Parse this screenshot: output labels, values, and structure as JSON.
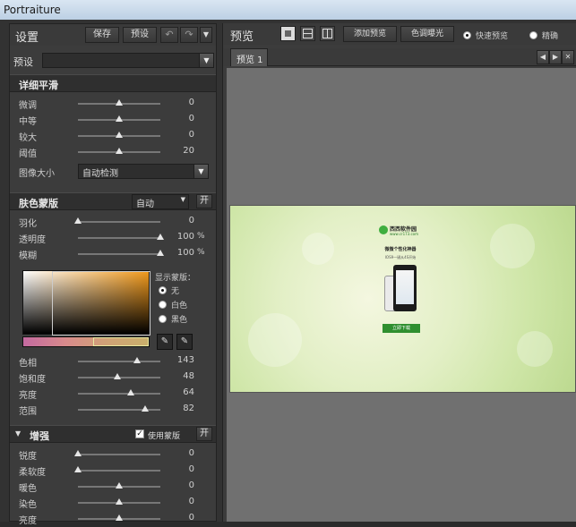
{
  "window": {
    "title": "Portraiture"
  },
  "settings": {
    "title": "设置",
    "save_label": "保存",
    "preset_label": "预设",
    "undo_icon": "undo-icon",
    "redo_icon": "redo-icon",
    "preset_row_label": "预设",
    "preset_value": ""
  },
  "detail_smoothing": {
    "title": "详细平滑",
    "sliders": [
      {
        "label": "微调",
        "value": "0",
        "position": 0.5
      },
      {
        "label": "中等",
        "value": "0",
        "position": 0.5
      },
      {
        "label": "较大",
        "value": "0",
        "position": 0.5
      },
      {
        "label": "阈值",
        "value": "20",
        "position": 0.5
      }
    ],
    "image_size_label": "图像大小",
    "image_size_value": "自动检测"
  },
  "skin_mask": {
    "title": "肤色蒙版",
    "mode_value": "自动",
    "toggle_label": "开",
    "sliders": [
      {
        "label": "羽化",
        "value": "0",
        "unit": "",
        "position": 0.0
      },
      {
        "label": "透明度",
        "value": "100",
        "unit": "%",
        "position": 1.0
      },
      {
        "label": "模糊",
        "value": "100",
        "unit": "%",
        "position": 1.0
      }
    ],
    "show_mask_label": "显示蒙版：",
    "show_mask_options": [
      {
        "label": "无",
        "selected": true
      },
      {
        "label": "白色",
        "selected": false
      },
      {
        "label": "黑色",
        "selected": false
      }
    ],
    "color_sliders": [
      {
        "label": "色相",
        "value": "143",
        "position": 0.72
      },
      {
        "label": "饱和度",
        "value": "48",
        "position": 0.48
      },
      {
        "label": "亮度",
        "value": "64",
        "position": 0.64
      },
      {
        "label": "范围",
        "value": "82",
        "position": 0.82
      }
    ]
  },
  "enhance": {
    "title": "增强",
    "use_mask_label": "使用蒙版",
    "use_mask_checked": true,
    "toggle_label": "开",
    "sliders": [
      {
        "label": "锐度",
        "value": "0",
        "position": 0.0
      },
      {
        "label": "柔软度",
        "value": "0",
        "position": 0.0
      },
      {
        "label": "暖色",
        "value": "0",
        "position": 0.5
      },
      {
        "label": "染色",
        "value": "0",
        "position": 0.5
      },
      {
        "label": "亮度",
        "value": "0",
        "position": 0.5
      }
    ]
  },
  "preview": {
    "title": "预览",
    "add_preview_label": "添加预览",
    "gamut_label": "色调曝光",
    "quick_preview_label": "快速预览",
    "accurate_label": "精确",
    "quick_selected": true,
    "tab_label": "预览 1",
    "image": {
      "site_name": "西西软件园",
      "site_url": "www.cr173.com",
      "headline": "微微个性化神器",
      "subline": "IOS9一键从4S开始",
      "download_label": "立即下载"
    }
  }
}
